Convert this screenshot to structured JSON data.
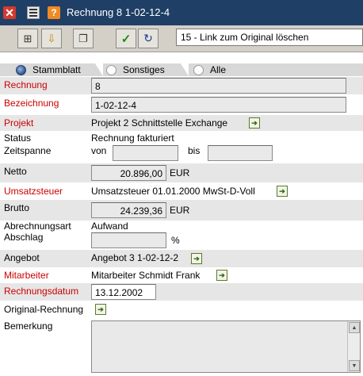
{
  "window": {
    "title": "Rechnung 8 1-02-12-4"
  },
  "titlebar_icons": {
    "close": "close-icon",
    "minimize": "minimize-icon",
    "help": "help-icon"
  },
  "toolbar": {
    "action_select_value": "15 - Link zum Original löschen",
    "buttons": [
      "tree-icon",
      "import-icon",
      "copy-icon",
      "check-icon",
      "refresh-icon"
    ]
  },
  "tabs": [
    {
      "label": "Stammblatt",
      "active": true
    },
    {
      "label": "Sonstiges",
      "active": false
    },
    {
      "label": "Alle",
      "active": false
    }
  ],
  "form": {
    "rechnung": {
      "label": "Rechnung",
      "value": "8"
    },
    "bezeichnung": {
      "label": "Bezeichnung",
      "value": "1-02-12-4"
    },
    "projekt": {
      "label": "Projekt",
      "value": "Projekt 2 Schnittstelle Exchange"
    },
    "status": {
      "label": "Status",
      "value": "Rechnung fakturiert"
    },
    "zeitspanne": {
      "label": "Zeitspanne",
      "from_label": "von",
      "to_label": "bis",
      "from_value": "",
      "to_value": ""
    },
    "netto": {
      "label": "Netto",
      "value": "20.896,00",
      "unit": "EUR"
    },
    "umsatzsteuer": {
      "label": "Umsatzsteuer",
      "value": "Umsatzsteuer 01.01.2000 MwSt-D-Voll"
    },
    "brutto": {
      "label": "Brutto",
      "value": "24.239,36",
      "unit": "EUR"
    },
    "abrechnungsart": {
      "label": "Abrechnungsart",
      "value": "Aufwand"
    },
    "abschlag": {
      "label": "Abschlag",
      "value": "",
      "unit": "%"
    },
    "angebot": {
      "label": "Angebot",
      "value": "Angebot 3 1-02-12-2"
    },
    "mitarbeiter": {
      "label": "Mitarbeiter",
      "value": "Mitarbeiter Schmidt Frank"
    },
    "rechnungsdatum": {
      "label": "Rechnungsdatum",
      "value": "13.12.2002"
    },
    "original_rechnung": {
      "label": "Original-Rechnung"
    },
    "bemerkung": {
      "label": "Bemerkung",
      "value": ""
    }
  },
  "colors": {
    "titlebar": "#1f3f66",
    "required_label": "#cc0000",
    "row_shade": "#e6e6e6"
  }
}
